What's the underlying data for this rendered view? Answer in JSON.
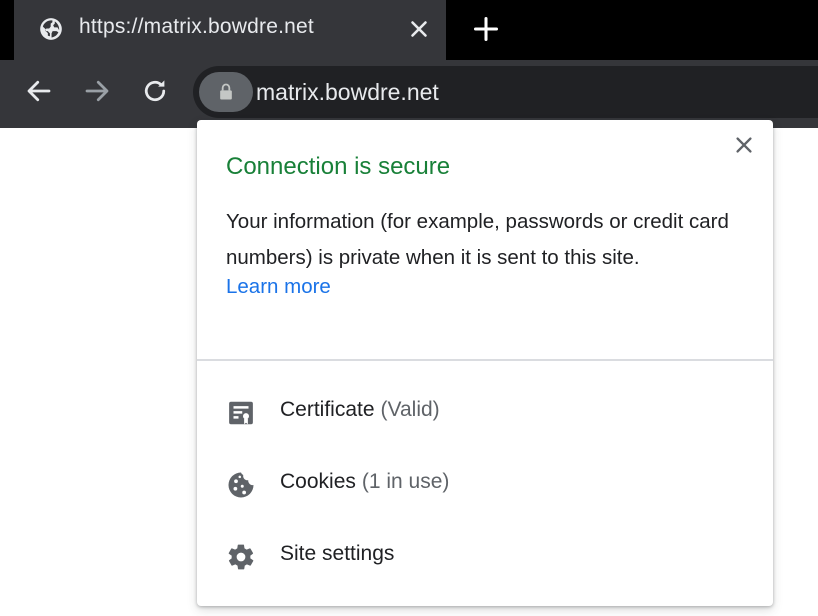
{
  "tab": {
    "title": "https://matrix.bowdre.net",
    "favicon_icon": "globe-icon",
    "close_icon": "close-icon"
  },
  "new_tab_icon": "plus-icon",
  "toolbar": {
    "back_icon": "arrow-left-icon",
    "forward_icon": "arrow-right-icon",
    "reload_icon": "reload-icon",
    "lock_icon": "lock-icon",
    "url": "matrix.bowdre.net"
  },
  "popup": {
    "title": "Connection is secure",
    "description": "Your information (for example, passwords or credit card numbers) is private when it is sent to this site.",
    "learn_more": "Learn more",
    "close_icon": "close-icon",
    "items": [
      {
        "label": "Certificate",
        "sub": "(Valid)",
        "icon": "certificate-icon"
      },
      {
        "label": "Cookies",
        "sub": "(1 in use)",
        "icon": "cookie-icon"
      },
      {
        "label": "Site settings",
        "sub": "",
        "icon": "gear-icon"
      }
    ]
  },
  "colors": {
    "title_green": "#188038",
    "link_blue": "#1a73e8",
    "toolbar_bg": "#35363a",
    "tabstrip_bg": "#000000"
  }
}
